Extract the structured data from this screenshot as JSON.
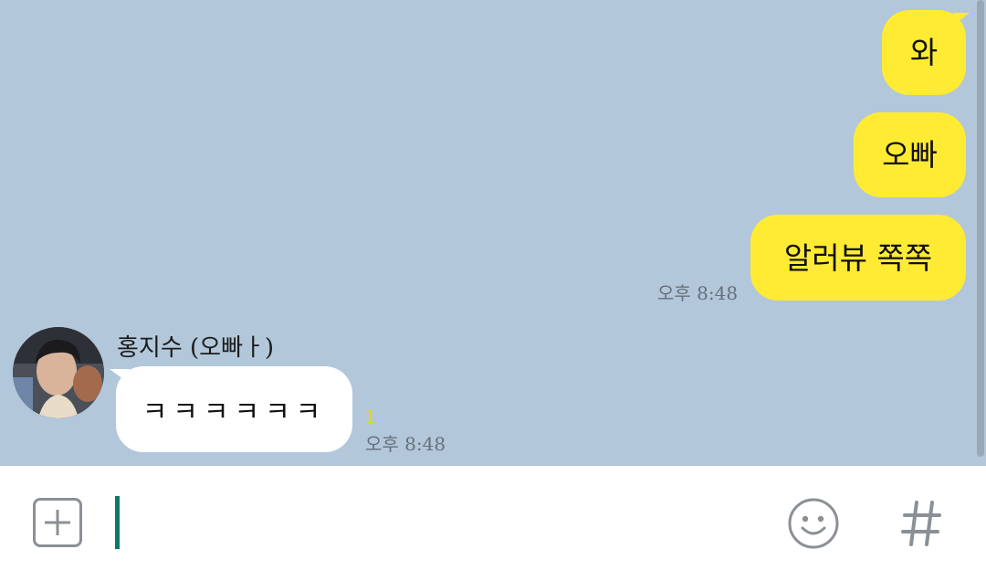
{
  "conversation": {
    "outgoing": [
      {
        "text": "와"
      },
      {
        "text": "오빠"
      },
      {
        "text": "알러뷰 쪽쪽",
        "time": "오후 8:48"
      }
    ],
    "incoming": {
      "sender": "홍지수 (오빠ㅏ)",
      "text": "ㅋㅋㅋㅋㅋㅋ",
      "unread": "1",
      "time": "오후 8:48"
    }
  },
  "input_bar": {
    "value": "",
    "icons": {
      "attach": "plus-square-icon",
      "emoji": "smiley-icon",
      "hashtag": "hashtag-icon"
    }
  },
  "colors": {
    "background": "#b2c7da",
    "outgoing_bubble": "#ffeb33",
    "incoming_bubble": "#ffffff",
    "cursor": "#0a7a6a"
  }
}
